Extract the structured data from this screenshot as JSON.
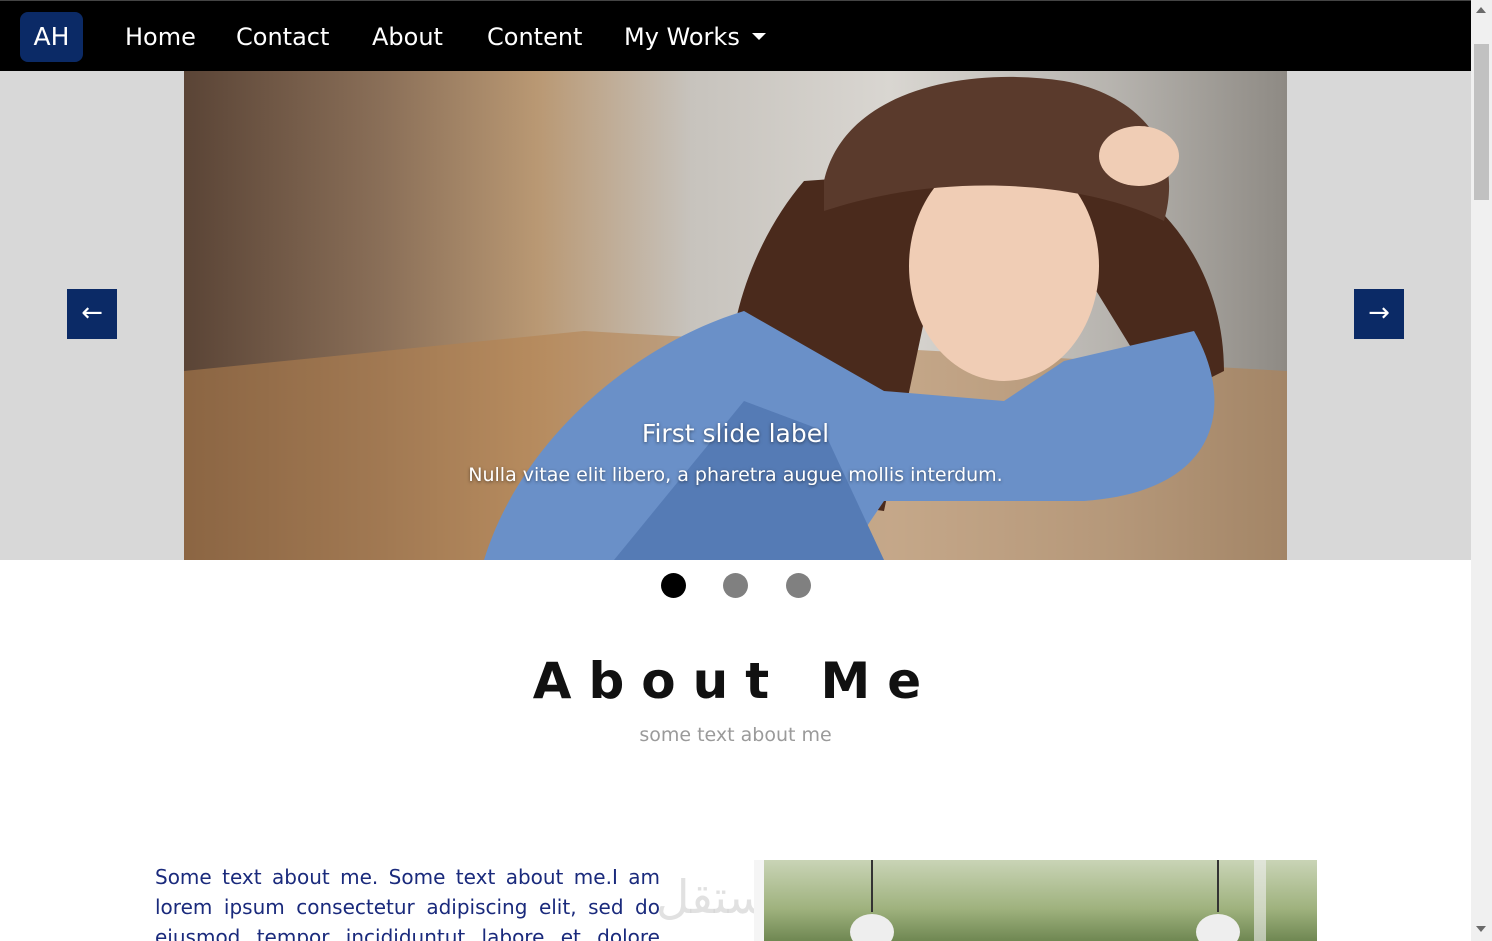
{
  "navbar": {
    "brand": "AH",
    "items": [
      {
        "label": "Home"
      },
      {
        "label": "Contact"
      },
      {
        "label": "About"
      },
      {
        "label": "Content"
      },
      {
        "label": "My Works"
      }
    ]
  },
  "carousel": {
    "caption_title": "First slide label",
    "caption_text": "Nulla vitae elit libero, a pharetra augue mollis interdum.",
    "prev_icon": "←",
    "next_icon": "→",
    "slide_count": 3,
    "active_slide": 1
  },
  "about": {
    "title": "About Me",
    "subtitle": "some text about me",
    "body": "Some text about me. Some text about me.I am lorem ipsum consectetur adipiscing elit, sed do eiusmod tempor incididuntut labore et dolore magna aliqua. Ut"
  },
  "colors": {
    "navbar_bg": "#000000",
    "brand_bg": "#0b2a66",
    "control_bg": "#0b2a66",
    "body_text": "#1a2a7c",
    "carousel_bg": "#d8d8d8"
  }
}
